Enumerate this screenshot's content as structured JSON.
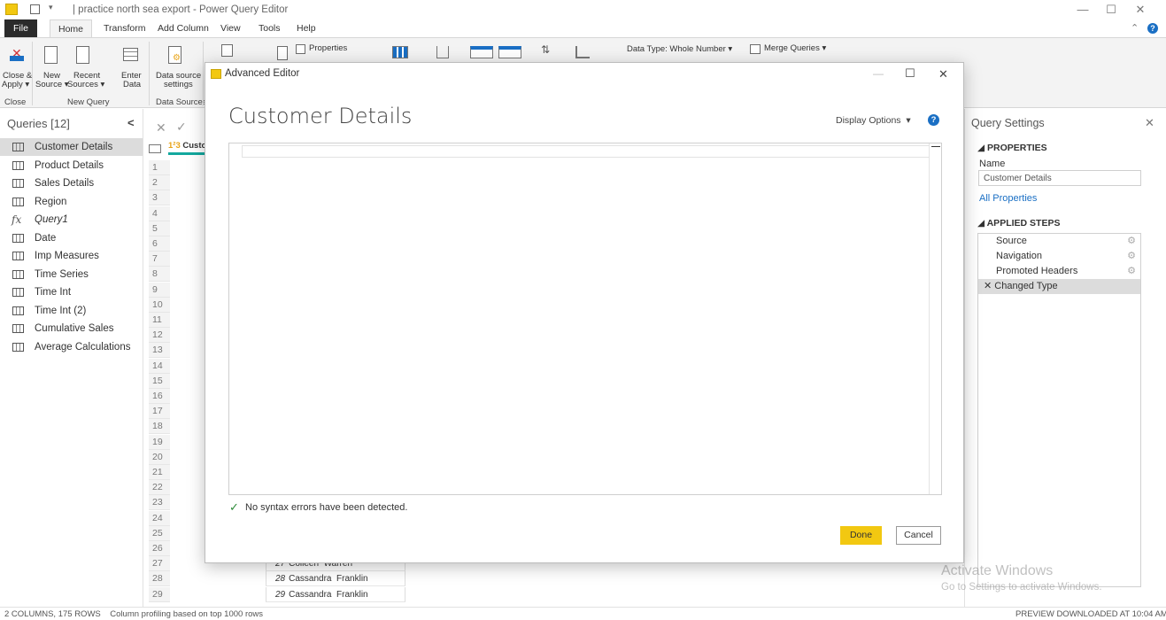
{
  "window": {
    "title": "| practice north sea export - Power Query Editor",
    "min_glyph": "—",
    "max_glyph": "☐",
    "close_glyph": "✕"
  },
  "ribbon_tabs": [
    "File",
    "Home",
    "Transform",
    "Add Column",
    "View",
    "Tools",
    "Help"
  ],
  "ribbon": {
    "close_apply": "Close &",
    "close_apply2": "Apply ▾",
    "new_source": "New",
    "new_source2": "Source ▾",
    "recent_sources": "Recent",
    "recent_sources2": "Sources ▾",
    "enter_data": "Enter",
    "enter_data2": "Data",
    "data_source_settings": "Data source",
    "data_source_settings2": "settings",
    "properties": "Properties",
    "data_type": "Data Type: Whole Number ▾",
    "merge_queries": "Merge Queries ▾",
    "groups": {
      "close": "Close",
      "new_query": "New Query",
      "data_sources": "Data Sources"
    }
  },
  "queries": {
    "header": "Queries [12]",
    "collapse": "<",
    "items": [
      {
        "label": "Customer Details",
        "type": "table"
      },
      {
        "label": "Product Details",
        "type": "table"
      },
      {
        "label": "Sales Details",
        "type": "table"
      },
      {
        "label": "Region",
        "type": "table"
      },
      {
        "label": "Query1",
        "type": "function"
      },
      {
        "label": "Date",
        "type": "table"
      },
      {
        "label": "Imp Measures",
        "type": "table"
      },
      {
        "label": "Time Series",
        "type": "table"
      },
      {
        "label": "Time Int",
        "type": "table"
      },
      {
        "label": "Time Int (2)",
        "type": "table"
      },
      {
        "label": "Cumulative Sales",
        "type": "table"
      },
      {
        "label": "Average Calculations",
        "type": "table"
      }
    ],
    "selected": "Customer Details"
  },
  "grid": {
    "formula_cancel": "✕",
    "formula_ok": "✓",
    "column_header": "Custo",
    "col_type": "1²3",
    "row_numbers": [
      "1",
      "2",
      "3",
      "4",
      "5",
      "6",
      "7",
      "8",
      "9",
      "10",
      "11",
      "12",
      "13",
      "14",
      "15",
      "16",
      "17",
      "18",
      "19",
      "20",
      "21",
      "22",
      "23",
      "24",
      "25",
      "26",
      "27",
      "28",
      "29"
    ],
    "visible_cells": [
      {
        "num": "27",
        "name": "Colleen  Warren"
      },
      {
        "num": "28",
        "name": "Cassandra  Franklin"
      },
      {
        "num": "29",
        "name": "Cassandra  Franklin"
      }
    ]
  },
  "settings": {
    "title": "Query Settings",
    "close": "✕",
    "properties_header": "◢ PROPERTIES",
    "name_label": "Name",
    "name_value": "Customer Details",
    "all_properties": "All Properties",
    "applied_steps_header": "◢ APPLIED STEPS",
    "steps": [
      {
        "label": "Source",
        "gear": true
      },
      {
        "label": "Navigation",
        "gear": true
      },
      {
        "label": "Promoted Headers",
        "gear": true
      },
      {
        "label": "✕ Changed Type",
        "gear": false
      }
    ]
  },
  "status": {
    "left": "2 COLUMNS, 175 ROWS    Column profiling based on top 1000 rows",
    "right": "PREVIEW DOWNLOADED AT 10:04 AM"
  },
  "watermark": {
    "line1": "Activate Windows",
    "line2": "Go to Settings to activate Windows."
  },
  "dialog": {
    "window_title": "Advanced Editor",
    "heading": "Customer Details",
    "display_options": "Display Options  ▾",
    "help": "?",
    "syntax_status": "No syntax errors have been detected.",
    "done": "Done",
    "cancel": "Cancel",
    "min_glyph": "—",
    "max_glyph": "☐",
    "close_glyph": "✕"
  },
  "colors": {
    "accent_yellow": "#f2c811",
    "selected_bg": "#dcdcdc",
    "ribbon_bg": "#f3f3f3",
    "help_blue": "#1a6fc4",
    "check_green": "#2e8b3a"
  }
}
